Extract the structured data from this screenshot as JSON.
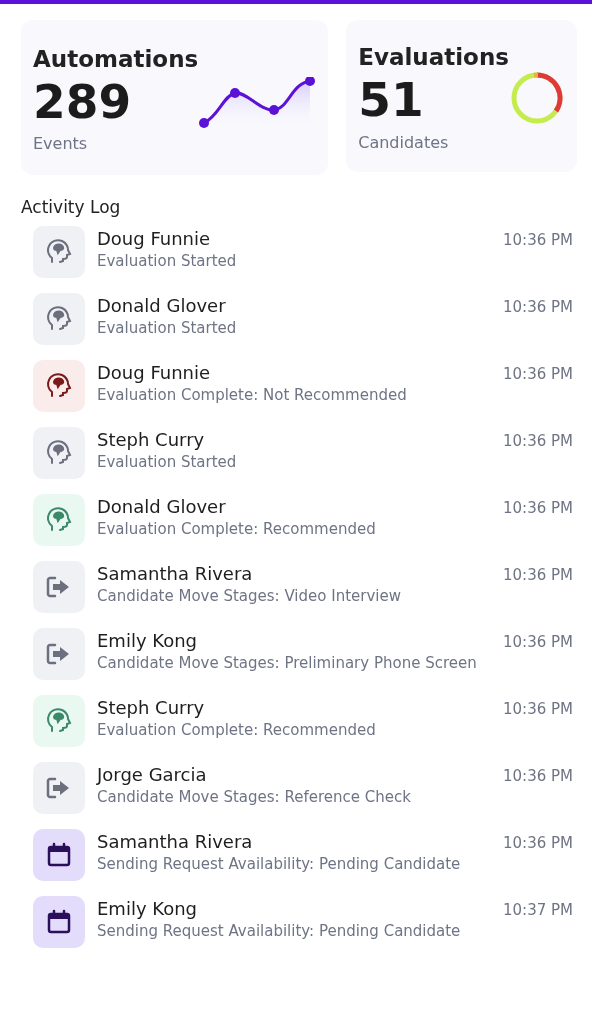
{
  "stats": [
    {
      "kind": "sparkline",
      "title": "Automations",
      "value": "289",
      "caption": "Events"
    },
    {
      "kind": "donut",
      "title": "Evaluations",
      "value": "51",
      "caption": "Candidates"
    }
  ],
  "activity_log": {
    "title": "Activity Log",
    "items": [
      {
        "kind": "evaluation_started",
        "name": "Doug Funnie",
        "detail": "Evaluation Started",
        "time": "10:36 PM"
      },
      {
        "kind": "evaluation_started",
        "name": "Donald Glover",
        "detail": "Evaluation Started",
        "time": "10:36 PM"
      },
      {
        "kind": "evaluation_negative",
        "name": "Doug Funnie",
        "detail": "Evaluation Complete: Not Recommended",
        "time": "10:36 PM"
      },
      {
        "kind": "evaluation_started",
        "name": "Steph Curry",
        "detail": "Evaluation Started",
        "time": "10:36 PM"
      },
      {
        "kind": "evaluation_positive",
        "name": "Donald Glover",
        "detail": "Evaluation Complete: Recommended",
        "time": "10:36 PM"
      },
      {
        "kind": "move",
        "name": "Samantha Rivera",
        "detail": "Candidate Move Stages: Video Interview",
        "time": "10:36 PM"
      },
      {
        "kind": "move",
        "name": "Emily Kong",
        "detail": "Candidate Move Stages: Preliminary Phone Screen",
        "time": "10:36 PM"
      },
      {
        "kind": "evaluation_positive",
        "name": "Steph Curry",
        "detail": "Evaluation Complete: Recommended",
        "time": "10:36 PM"
      },
      {
        "kind": "move",
        "name": "Jorge Garcia",
        "detail": "Candidate Move Stages: Reference Check",
        "time": "10:36 PM"
      },
      {
        "kind": "schedule",
        "name": "Samantha Rivera",
        "detail": "Sending Request Availability: Pending Candidate",
        "time": "10:36 PM"
      },
      {
        "kind": "schedule",
        "name": "Emily Kong",
        "detail": "Sending Request Availability: Pending Candidate",
        "time": "10:37 PM"
      }
    ]
  }
}
